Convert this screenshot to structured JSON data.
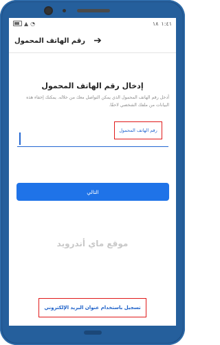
{
  "status_bar": {
    "time": "١:٤١",
    "notification": "١٨",
    "battery_percent": 72
  },
  "header": {
    "title": "رقم الهاتف المحمول",
    "back_icon": "arrow-right-icon"
  },
  "main": {
    "heading": "إدخال رقم الهاتف المحمول",
    "description": "أدخل رقم الهاتف المحمول الذي يمكن التواصل معك من خلاله. يمكنك إخفاء هذه البيانات من ملفك الشخصي لاحقًا.",
    "field_label": "رقم الهاتف المحمول",
    "input_value": "",
    "next_button": "التالي",
    "watermark": "موقع ماي أندرويد",
    "email_link": "تسجيل باستخدام عنوان البريد الإلكتروني"
  },
  "colors": {
    "accent": "#1f73e8",
    "highlight_border": "#e01818",
    "phone_frame": "#1e4f86"
  }
}
